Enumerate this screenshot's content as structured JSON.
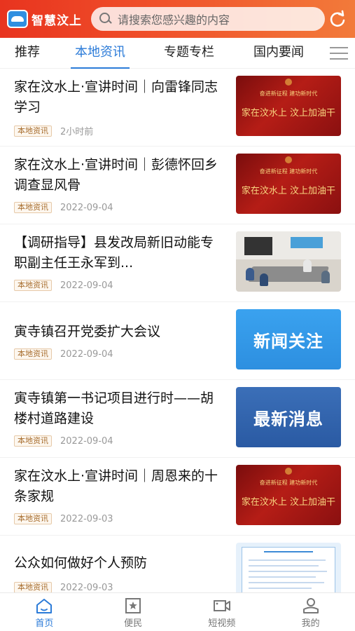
{
  "header": {
    "logo_text": "智慧汶上",
    "search_placeholder": "请搜索您感兴趣的内容"
  },
  "tabs": [
    {
      "label": "推荐",
      "active": false
    },
    {
      "label": "本地资讯",
      "active": true
    },
    {
      "label": "专题专栏",
      "active": false
    },
    {
      "label": "国内要闻",
      "active": false
    }
  ],
  "articles": [
    {
      "title": "家在汶水上·宣讲时间｜向雷锋同志学习",
      "tag": "本地资讯",
      "time": "2小时前",
      "thumb_kind": "red-banner",
      "thumb_text": "家在汶水上 汶上加油干"
    },
    {
      "title": "家在汶水上·宣讲时间｜彭德怀回乡调查显风骨",
      "tag": "本地资讯",
      "time": "2022-09-04",
      "thumb_kind": "red-banner",
      "thumb_text": "家在汶水上 汶上加油干"
    },
    {
      "title": "【调研指导】县发改局新旧动能专职副主任王永军到...",
      "tag": "本地资讯",
      "time": "2022-09-04",
      "thumb_kind": "meeting-photo",
      "thumb_text": ""
    },
    {
      "title": "寅寺镇召开党委扩大会议",
      "tag": "本地资讯",
      "time": "2022-09-04",
      "thumb_kind": "blue-text",
      "thumb_text": "新闻关注"
    },
    {
      "title": "寅寺镇第一书记项目进行时——胡楼村道路建设",
      "tag": "本地资讯",
      "time": "2022-09-04",
      "thumb_kind": "blue-text",
      "thumb_text": "最新消息"
    },
    {
      "title": "家在汶水上·宣讲时间｜周恩来的十条家规",
      "tag": "本地资讯",
      "time": "2022-09-03",
      "thumb_kind": "red-banner",
      "thumb_text": "家在汶水上 汶上加油干"
    },
    {
      "title": "公众如何做好个人预防",
      "tag": "本地资讯",
      "time": "2022-09-03",
      "thumb_kind": "document",
      "thumb_text": ""
    }
  ],
  "bottom_nav": [
    {
      "label": "首页",
      "icon": "home-icon",
      "active": true
    },
    {
      "label": "便民",
      "icon": "star-bookmark-icon",
      "active": false
    },
    {
      "label": "短视频",
      "icon": "video-camera-icon",
      "active": false
    },
    {
      "label": "我的",
      "icon": "user-icon",
      "active": false
    }
  ],
  "colors": {
    "header_start": "#e8341f",
    "header_end": "#f27a3a",
    "accent_blue": "#2b7bd8",
    "tag_text": "#a66b2b"
  }
}
